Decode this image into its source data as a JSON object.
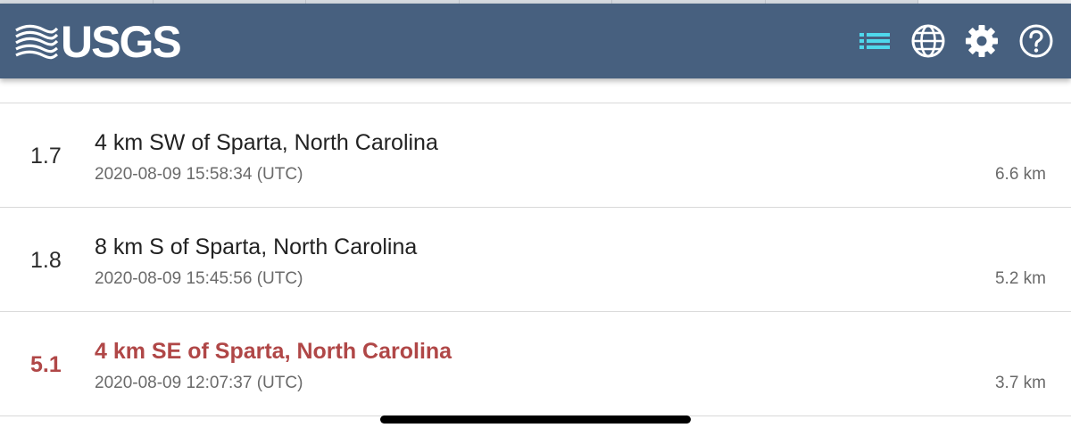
{
  "app": {
    "logo_text": "USGS",
    "accent_color": "#47607f",
    "list_icon_color": "#4fd8ec"
  },
  "header": {
    "icons": [
      "list-icon",
      "globe-icon",
      "gear-icon",
      "help-icon"
    ]
  },
  "earthquakes": [
    {
      "magnitude": "1.7",
      "place": "4 km SW of Sparta, North Carolina",
      "time": "2020-08-09 15:58:34 (UTC)",
      "depth": "6.6 km",
      "significant": false
    },
    {
      "magnitude": "1.8",
      "place": "8 km S of Sparta, North Carolina",
      "time": "2020-08-09 15:45:56 (UTC)",
      "depth": "5.2 km",
      "significant": false
    },
    {
      "magnitude": "5.1",
      "place": "4 km SE of Sparta, North Carolina",
      "time": "2020-08-09 12:07:37 (UTC)",
      "depth": "3.7 km",
      "significant": true,
      "highlight_color": "#b04747"
    }
  ]
}
